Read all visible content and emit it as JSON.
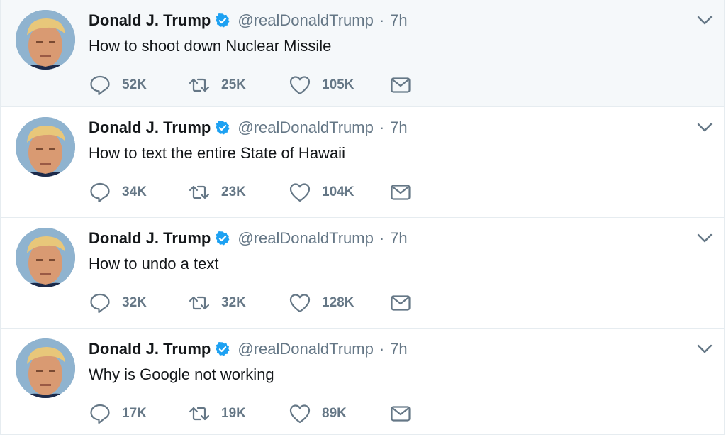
{
  "tweets": [
    {
      "name": "Donald J. Trump",
      "handle": "@realDonaldTrump",
      "separator": "·",
      "time": "7h",
      "text": "How to shoot down Nuclear Missile",
      "replies": "52K",
      "retweets": "25K",
      "likes": "105K"
    },
    {
      "name": "Donald J. Trump",
      "handle": "@realDonaldTrump",
      "separator": "·",
      "time": "7h",
      "text": "How to text the entire State of Hawaii",
      "replies": "34K",
      "retweets": "23K",
      "likes": "104K"
    },
    {
      "name": "Donald J. Trump",
      "handle": "@realDonaldTrump",
      "separator": "·",
      "time": "7h",
      "text": "How to undo a text",
      "replies": "32K",
      "retweets": "32K",
      "likes": "128K"
    },
    {
      "name": "Donald J. Trump",
      "handle": "@realDonaldTrump",
      "separator": "·",
      "time": "7h",
      "text": "Why is Google not working",
      "replies": "17K",
      "retweets": "19K",
      "likes": "89K"
    }
  ],
  "icons": {
    "verified": "verified-badge-icon",
    "caret": "chevron-down-icon",
    "reply": "reply-icon",
    "retweet": "retweet-icon",
    "like": "heart-icon",
    "dm": "envelope-icon"
  },
  "colors": {
    "text": "#14171a",
    "secondary": "#657786",
    "verified": "#1da1f2",
    "border": "#e6ecf0",
    "highlight_background": "#f5f8fa"
  }
}
